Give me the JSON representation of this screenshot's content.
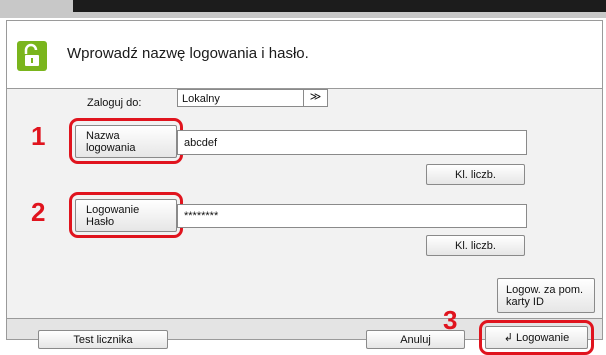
{
  "dialog": {
    "title": "Wprowadź nazwę logowania i hasło."
  },
  "login_to": {
    "label": "Zaloguj do:",
    "value": "Lokalny",
    "arrow": "≫"
  },
  "username": {
    "button_label_line1": "Nazwa",
    "button_label_line2": "logowania",
    "value": "abcdef",
    "keypad_label": "Kl. liczb.",
    "step_number": "1"
  },
  "password": {
    "button_label_line1": "Logowanie",
    "button_label_line2": "Hasło",
    "value": "********",
    "keypad_label": "Kl. liczb.",
    "step_number": "2"
  },
  "id_card_login": {
    "label_line1": "Logow. za pom.",
    "label_line2": "karty ID"
  },
  "footer": {
    "test_counter": "Test licznika",
    "cancel": "Anuluj",
    "login": "Logowanie",
    "login_icon": "↲",
    "step_number": "3"
  },
  "colors": {
    "highlight": "#e0141e",
    "lock_icon": "#7ab51d"
  },
  "icons": [
    "unlock-icon",
    "return-arrow-icon",
    "dropdown-arrow-icon"
  ]
}
